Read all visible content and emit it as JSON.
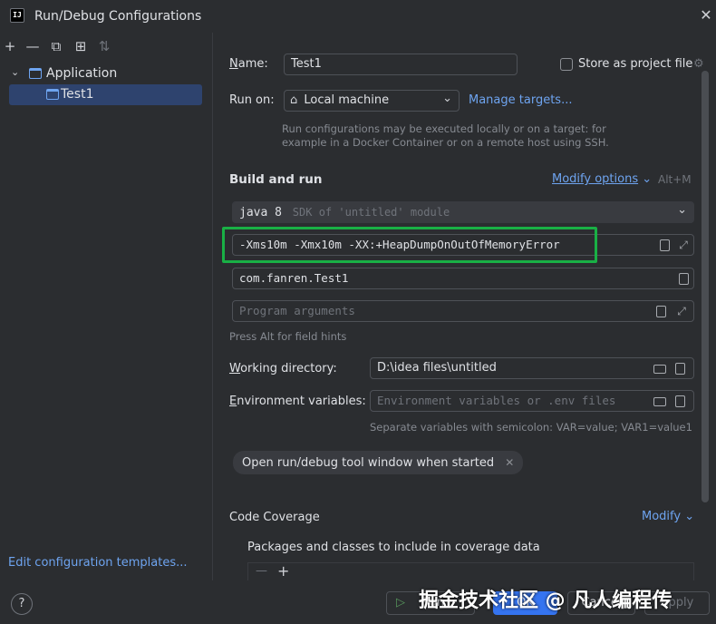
{
  "window": {
    "title": "Run/Debug Configurations",
    "app_icon_text": "IJ"
  },
  "left_toolbar": {
    "icons": [
      "add-icon",
      "remove-icon",
      "copy-icon",
      "folder-add-icon",
      "sort-icon"
    ]
  },
  "tree": {
    "group_label": "Application",
    "items": [
      {
        "label": "Test1",
        "selected": true
      }
    ]
  },
  "left_footer": {
    "edit_templates": "Edit configuration templates..."
  },
  "form": {
    "name_label": "Name:",
    "name_value": "Test1",
    "store_label": "Store as project file",
    "store_checked": false,
    "run_on_label": "Run on:",
    "run_on_value": "Local machine",
    "manage_targets": "Manage targets...",
    "run_on_hint_1": "Run configurations may be executed locally or on a target: for",
    "run_on_hint_2": "example in a Docker Container or on a remote host using SSH.",
    "build_run_title": "Build and run",
    "modify_options": "Modify options",
    "modify_shortcut": "Alt+M",
    "sdk_value": "java 8",
    "sdk_hint": "SDK of 'untitled' module",
    "vm_options": "-Xms10m -Xmx10m -XX:+HeapDumpOnOutOfMemoryError",
    "main_class": "com.fanren.Test1",
    "program_args_placeholder": "Program arguments",
    "field_hints": "Press Alt for field hints",
    "working_dir_label": "Working directory:",
    "working_dir_value": "D:\\idea files\\untitled",
    "env_label": "Environment variables:",
    "env_placeholder": "Environment variables or .env files",
    "env_hint": "Separate variables with semicolon: VAR=value; VAR1=value1",
    "open_tool_window_chip": "Open run/debug tool window when started",
    "code_coverage_title": "Code Coverage",
    "modify_link": "Modify",
    "packages_label": "Packages and classes to include in coverage data"
  },
  "bottom": {
    "help": "?",
    "run_button": "Run",
    "ok_button": "OK",
    "cancel_button": "Cancel",
    "apply_button": "Apply",
    "watermark": "掘金技术社区 @ 凡人编程传"
  },
  "colors": {
    "accent": "#3574f0",
    "link": "#6ea4f0",
    "highlight_box": "#19b045",
    "selection": "#2e436e"
  }
}
